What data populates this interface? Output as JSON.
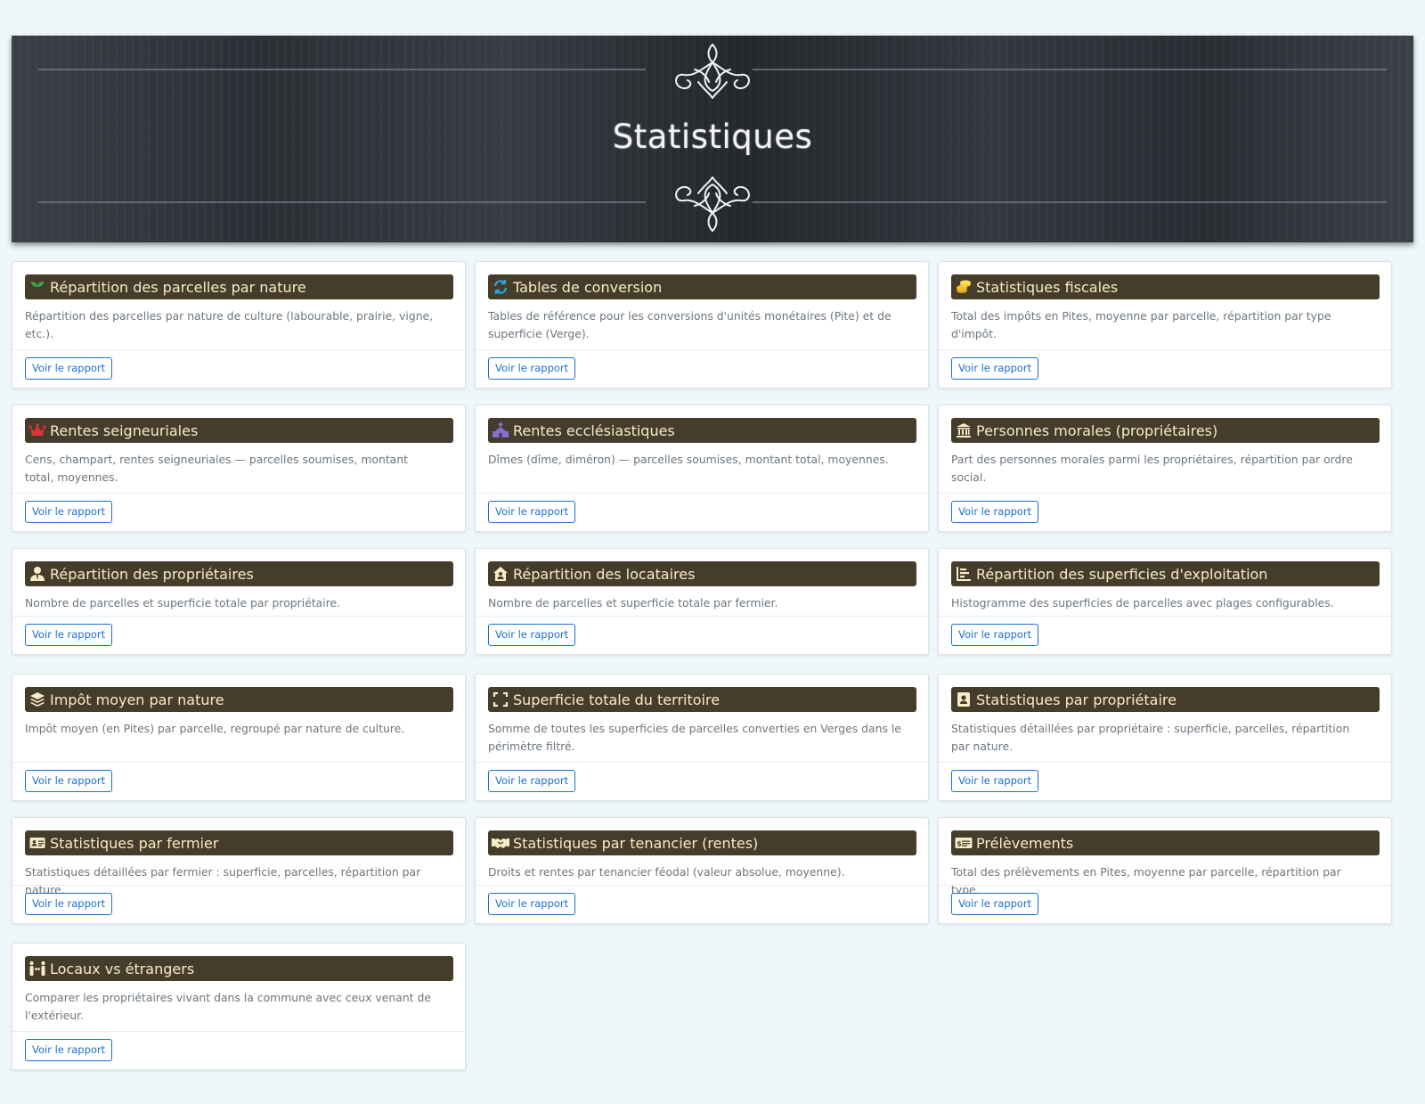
{
  "header": {
    "title": "Statistiques"
  },
  "button_label": "Voir le rapport",
  "colors": {
    "card_header": "#463c2b",
    "card_title": "#f6ecc6",
    "button": "#1a6fd1",
    "background": "#eef8fa"
  },
  "cards": [
    {
      "title": "Répartition des parcelles par nature",
      "icon": "seedling-icon",
      "description": "Répartition des parcelles par nature de culture (labourable, prairie, vigne, etc.)."
    },
    {
      "title": "Tables de conversion",
      "icon": "sync-icon",
      "description": "Tables de référence pour les conversions d'unités monétaires (Pite) et de superficie (Verge)."
    },
    {
      "title": "Statistiques fiscales",
      "icon": "coins-icon",
      "description": "Total des impôts en Pites, moyenne par parcelle, répartition par type d'impôt."
    },
    {
      "title": "Rentes seigneuriales",
      "icon": "crown-icon",
      "description": "Cens, champart, rentes seigneuriales — parcelles soumises, montant total, moyennes."
    },
    {
      "title": "Rentes ecclésiastiques",
      "icon": "church-icon",
      "description": "Dîmes (dîme, diméron) — parcelles soumises, montant total, moyennes."
    },
    {
      "title": "Personnes morales (propriétaires)",
      "icon": "landmark-icon",
      "description": "Part des personnes morales parmi les propriétaires, répartition par ordre social."
    },
    {
      "title": "Répartition des propriétaires",
      "icon": "user-tie-icon",
      "description": "Nombre de parcelles et superficie totale par propriétaire."
    },
    {
      "title": "Répartition des locataires",
      "icon": "house-user-icon",
      "description": "Nombre de parcelles et superficie totale par fermier."
    },
    {
      "title": "Répartition des superficies d'exploitation",
      "icon": "bar-chart-icon",
      "description": "Histogramme des superficies de parcelles avec plages configurables."
    },
    {
      "title": "Impôt moyen par nature",
      "icon": "layers-icon",
      "description": "Impôt moyen (en Pites) par parcelle, regroupé par nature de culture."
    },
    {
      "title": "Superficie totale du territoire",
      "icon": "expand-icon",
      "description": "Somme de toutes les superficies de parcelles converties en Verges dans le périmètre filtré."
    },
    {
      "title": "Statistiques par propriétaire",
      "icon": "user-badge-icon",
      "description": "Statistiques détaillées par propriétaire : superficie, parcelles, répartition par nature."
    },
    {
      "title": "Statistiques par fermier",
      "icon": "id-card-icon",
      "description": "Statistiques détaillées par fermier : superficie, parcelles, répartition par nature."
    },
    {
      "title": "Statistiques par tenancier (rentes)",
      "icon": "handshake-icon",
      "description": "Droits et rentes par tenancier féodal (valeur absolue, moyenne)."
    },
    {
      "title": "Prélèvements",
      "icon": "money-check-icon",
      "description": "Total des prélèvements en Pites, moyenne par parcelle, répartition par type."
    },
    {
      "title": "Locaux vs étrangers",
      "icon": "people-arrows-icon",
      "description": "Comparer les propriétaires vivant dans la commune avec ceux venant de l'extérieur."
    }
  ]
}
